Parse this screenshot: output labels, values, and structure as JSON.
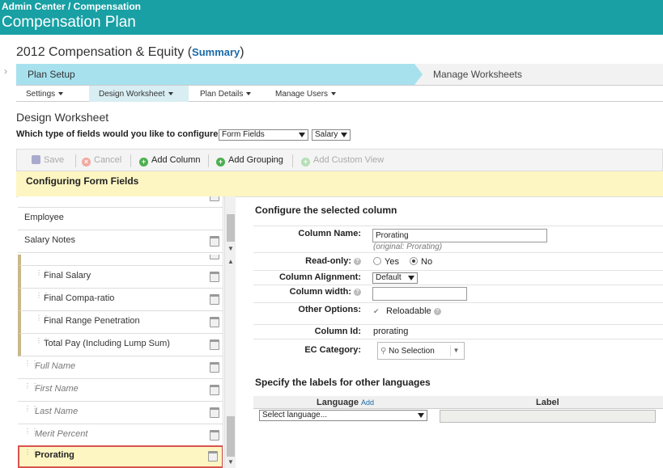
{
  "header": {
    "breadcrumb": "Admin Center / Compensation",
    "title": "Compensation Plan"
  },
  "plan": {
    "title": "2012 Compensation & Equity",
    "summary_open": "(",
    "summary_link": "Summary",
    "summary_close": ")"
  },
  "steps": {
    "active": "Plan Setup",
    "next": "Manage Worksheets"
  },
  "subtabs": [
    "Settings",
    "Design Worksheet",
    "Plan Details",
    "Manage Users"
  ],
  "section_title": "Design Worksheet",
  "question": {
    "label": "Which type of fields would you like to configure:",
    "field_type": "Form Fields",
    "category": "Salary"
  },
  "toolbar": {
    "save": "Save",
    "cancel": "Cancel",
    "add_column": "Add Column",
    "add_grouping": "Add Grouping",
    "add_custom_view": "Add Custom View"
  },
  "config_bar": "Configuring Form Fields",
  "top_list": [
    {
      "label": "Employee"
    },
    {
      "label": "Salary Notes"
    }
  ],
  "bottom_list": [
    {
      "label": "Final Salary"
    },
    {
      "label": "Final Compa-ratio"
    },
    {
      "label": "Final Range Penetration"
    },
    {
      "label": "Total Pay (Including Lump Sum)"
    },
    {
      "label": "Full Name"
    },
    {
      "label": "First Name"
    },
    {
      "label": "Last Name"
    },
    {
      "label": "Merit Percent"
    },
    {
      "label": "Prorating"
    }
  ],
  "configure": {
    "heading": "Configure the selected column",
    "column_name_label": "Column Name:",
    "column_name_value": "Prorating",
    "original": "(original: Prorating)",
    "readonly_label": "Read-only:",
    "yes": "Yes",
    "no": "No",
    "alignment_label": "Column Alignment:",
    "alignment_value": "Default",
    "width_label": "Column width:",
    "other_label": "Other Options:",
    "reloadable": "Reloadable",
    "column_id_label": "Column Id:",
    "column_id_value": "prorating",
    "ec_label": "EC Category:",
    "ec_value": "No Selection"
  },
  "languages": {
    "heading": "Specify the labels for other languages",
    "language_col": "Language",
    "add_link": "Add",
    "label_col": "Label",
    "select_placeholder": "Select language..."
  }
}
